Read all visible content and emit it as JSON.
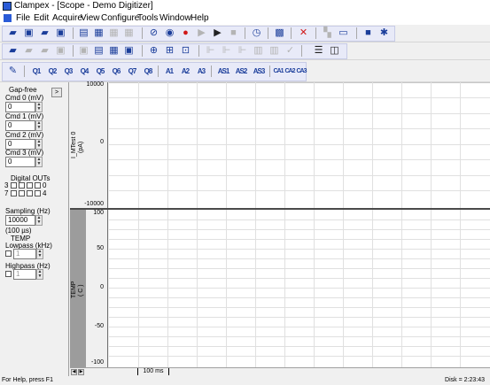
{
  "window": {
    "title": "Clampex - [Scope - Demo Digitizer]"
  },
  "menu": [
    "File",
    "Edit",
    "Acquire",
    "View",
    "Configure",
    "Tools",
    "Window",
    "Help"
  ],
  "toolbar_icons": {
    "row1": [
      "open-icon",
      "save-icon",
      "open-protocol-icon",
      "save-protocol-icon",
      "edit-icon",
      "print-preview-icon",
      "view-icon",
      "grid-icon",
      "abort-icon",
      "view-only-icon",
      "record-icon",
      "rerecord-icon",
      "play-icon",
      "stop-icon",
      "timer-icon",
      "membrane-test-icon",
      "lab-bench-icon",
      "seal-test-icon",
      "junction-icon",
      "export-icon",
      "trigger-icon"
    ],
    "row2": [
      "open-file-icon",
      "clipboard-icon",
      "copy-icon",
      "paste-icon",
      "print-icon",
      "lock-icon",
      "list-icon",
      "zoom-icon",
      "zoom-out-icon",
      "pan-icon",
      "cursor-icon",
      "measure-icon",
      "fit-icon",
      "check-icon",
      "window-split-icon",
      "tile-icon"
    ],
    "row3_labels": [
      "Q1",
      "Q2",
      "Q3",
      "Q4",
      "Q5",
      "Q6",
      "Q7",
      "Q8",
      "A1",
      "A2",
      "A3",
      "AS1",
      "AS2",
      "AS3",
      "CA1",
      "CA2",
      "CA3"
    ]
  },
  "sidebar": {
    "toggle_label": ">",
    "mode": "Gap-free",
    "cmd": [
      {
        "label": "Cmd 0 (mV)",
        "value": "0"
      },
      {
        "label": "Cmd 1 (mV)",
        "value": "0"
      },
      {
        "label": "Cmd 2 (mV)",
        "value": "0"
      },
      {
        "label": "Cmd 3 (mV)",
        "value": "0"
      }
    ],
    "digital_outs_label": "Digital OUTs",
    "digital_row1": {
      "left": "3",
      "right": "0"
    },
    "digital_row2": {
      "left": "7",
      "right": "4"
    },
    "sampling_label": "Sampling (Hz)",
    "sampling_value": "10000",
    "sampling_interval": "(100 µs)",
    "temp_label": "TEMP",
    "lowpass_label": "Lowpass (kHz)",
    "lowpass_value": "1",
    "highpass_label": "Highpass (Hz)",
    "highpass_value": "1"
  },
  "channels": [
    {
      "name": "I_MTest 0",
      "unit": "(pA)",
      "ticks": [
        "10000",
        "0",
        "-10000"
      ]
    },
    {
      "name": "TEMP",
      "unit": "( C )",
      "ticks": [
        "100",
        "50",
        "0",
        "-50",
        "-100"
      ]
    }
  ],
  "timebar": {
    "scale": "100 ms"
  },
  "status": {
    "left": "For Help, press F1",
    "right": "Disk = 2:23:43"
  },
  "colors": {
    "toolbar_group": "#e8eaf8",
    "record": "#d01818",
    "trace_area": "#ffffff"
  }
}
